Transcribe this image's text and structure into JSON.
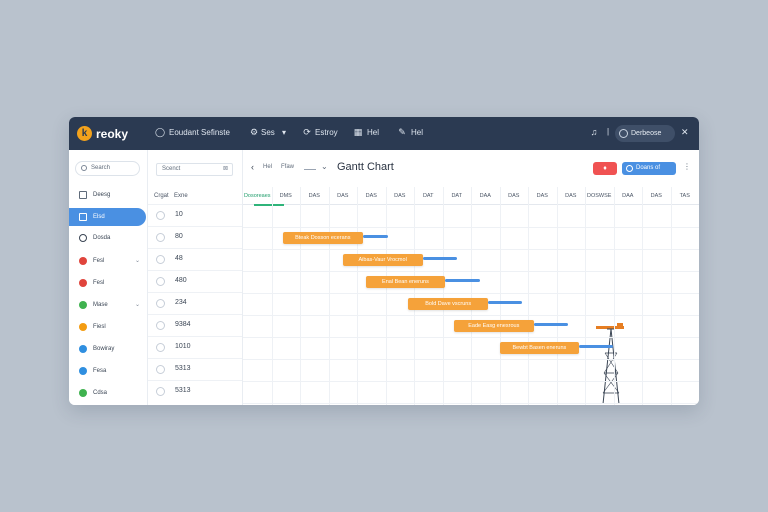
{
  "app": {
    "brand": "reoky",
    "logo_letter": "k",
    "nav": [
      {
        "label": "Eoudant Sefinste",
        "icon": "circle-icon"
      },
      {
        "label": "Ses",
        "icon": "gear-icon"
      },
      {
        "label": "Estroy",
        "icon": "refresh-icon"
      },
      {
        "label": "Hel",
        "icon": "grid-icon"
      },
      {
        "label": "Hel",
        "icon": "edit-icon"
      }
    ],
    "user_label": "Derbeose",
    "close_symbol": "✕"
  },
  "sidebar": {
    "search_placeholder": "Search",
    "items": [
      {
        "label": "Deesg",
        "icon": "folder-icon",
        "color": "#5f6b7a"
      },
      {
        "label": "Elsd",
        "icon": "list-icon",
        "color": "#ffffff",
        "active": true
      },
      {
        "label": "Dosda",
        "icon": "search-icon",
        "color": "#5f6b7a"
      },
      {
        "label": "Fesl",
        "icon": "dot-icon",
        "color": "#e0443c"
      },
      {
        "label": "Fesl",
        "icon": "dot-icon",
        "color": "#e0443c"
      },
      {
        "label": "Mase",
        "icon": "dot-icon",
        "color": "#3fb24f"
      },
      {
        "label": "Fiesl",
        "icon": "dot-icon",
        "color": "#f39c12"
      },
      {
        "label": "Bowiray",
        "icon": "dot-icon",
        "color": "#2f8fe0"
      },
      {
        "label": "Fesa",
        "icon": "dot-icon",
        "color": "#2f8fe0"
      },
      {
        "label": "Cdsa",
        "icon": "dot-icon",
        "color": "#3fb24f"
      }
    ]
  },
  "list": {
    "input_value": "Scenct",
    "col1": "Crgat",
    "col2": "Exne",
    "values": [
      "10",
      "80",
      "48",
      "480",
      "234",
      "9384",
      "1010",
      "5313",
      "5313"
    ]
  },
  "gantt": {
    "crumb1": "Hel",
    "crumb2": "Ffaw",
    "title": "Gantt Chart",
    "btn_red_label": "♦",
    "btn_blue_label": "Doans of",
    "more": "⋮",
    "timeline": [
      "Dosoreaes",
      "DMS",
      "DAS",
      "DAS",
      "DAS",
      "DAS",
      "DAT",
      "DAT",
      "DAA",
      "DAS",
      "DAS",
      "DAS",
      "DOSWSE",
      "DAA",
      "DAS",
      "TAS"
    ],
    "tasks": [
      {
        "label": "Bteak Dosson ecerans",
        "start": 1.4,
        "duration": 2.8,
        "link": 0.9
      },
      {
        "label": "Aibas-Vaur Vrocmol",
        "start": 3.5,
        "duration": 2.8,
        "link": 1.2
      },
      {
        "label": "Enal Bean eneruns",
        "start": 4.3,
        "duration": 2.8,
        "link": 1.2
      },
      {
        "label": "Bold Dave vscruns",
        "start": 5.8,
        "duration": 2.8,
        "link": 1.2
      },
      {
        "label": "Eade Easg enesrous",
        "start": 7.4,
        "duration": 2.8,
        "link": 1.2
      },
      {
        "label": "Bewbt Basen eneruns",
        "start": 9.0,
        "duration": 2.8,
        "link": 1.2
      }
    ]
  },
  "colors": {
    "topbar": "#2b3a52",
    "accent": "#4a90e2",
    "bar": "#f5a23a",
    "today": "#2fb47a"
  }
}
